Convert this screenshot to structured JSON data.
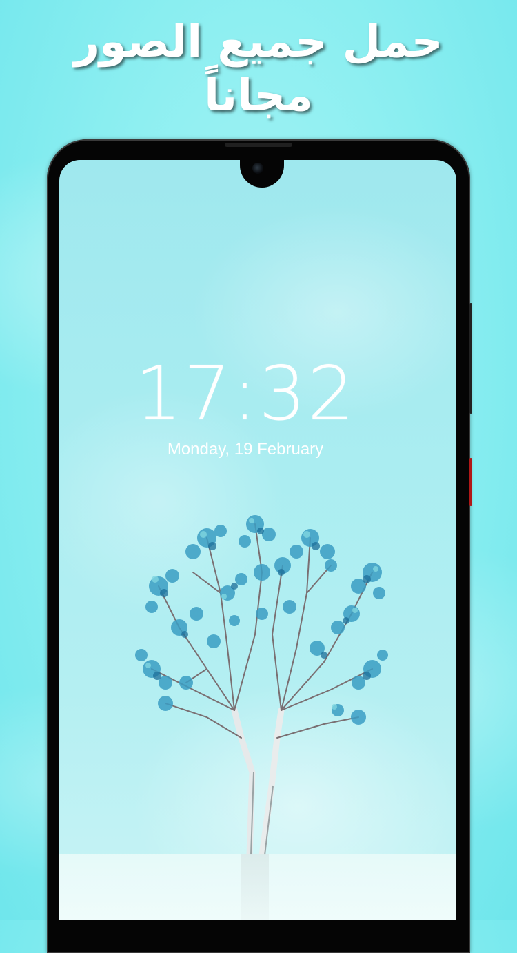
{
  "promo": {
    "headline_line1": "حمل جميع الصور",
    "headline_line2": "مجاناً"
  },
  "lockscreen": {
    "time": "17:32",
    "date": "Monday, 19 February"
  },
  "colors": {
    "background": "#8eeff1",
    "phone_frame": "#050505",
    "power_button": "#b01818",
    "headline_text": "#ffffff",
    "leaf_blue": "#3b9ec4"
  },
  "icons": {
    "front_camera": "camera-lens",
    "tree_wallpaper": "tree-illustration"
  }
}
